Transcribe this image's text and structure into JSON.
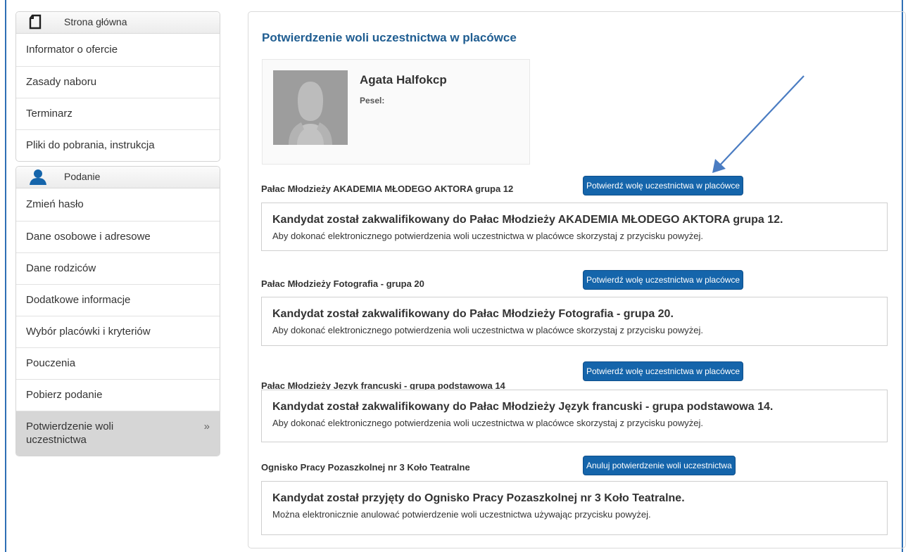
{
  "sidebar": {
    "home_panel": {
      "title": "Strona główna",
      "items": [
        "Informator o ofercie",
        "Zasady naboru",
        "Terminarz",
        "Pliki do pobrania, instrukcja"
      ]
    },
    "application_panel": {
      "title": "Podanie",
      "items": [
        "Zmień hasło",
        "Dane osobowe i adresowe",
        "Dane rodziców",
        "Dodatkowe informacje",
        "Wybór placówki i kryteriów",
        "Pouczenia",
        "Pobierz podanie"
      ],
      "active_item": "Potwierdzenie woli uczestnictwa",
      "active_chevron": "»"
    }
  },
  "main": {
    "title": "Potwierdzenie woli uczestnictwa w placówce",
    "candidate": {
      "name": "Agata Halfokcp",
      "pesel_label": "Pesel:"
    },
    "entries": [
      {
        "label": "Pałac Młodzieży AKADEMIA MŁODEGO AKTORA grupa 12",
        "button": "Potwierdź wolę uczestnictwa w placówce",
        "status": "Kandydat został zakwalifikowany do Pałac Młodzieży AKADEMIA MŁODEGO AKTORA grupa 12.",
        "info": "Aby dokonać elektronicznego potwierdzenia woli uczestnictwa w placówce skorzystaj z przycisku powyżej."
      },
      {
        "label": "Pałac Młodzieży Fotografia - grupa 20",
        "button": "Potwierdź wolę uczestnictwa w placówce",
        "status": "Kandydat został zakwalifikowany do Pałac Młodzieży Fotografia - grupa 20.",
        "info": "Aby dokonać elektronicznego potwierdzenia woli uczestnictwa w placówce skorzystaj z przycisku powyżej."
      },
      {
        "label": "Pałac Młodzieży Język francuski - grupa podstawowa 14",
        "button": "Potwierdź wolę uczestnictwa w placówce",
        "status": "Kandydat został zakwalifikowany do Pałac Młodzieży Język francuski - grupa podstawowa 14.",
        "info": "Aby dokonać elektronicznego potwierdzenia woli uczestnictwa w placówce skorzystaj z przycisku powyżej."
      },
      {
        "label": "Ognisko Pracy Pozaszkolnej nr 3 Koło Teatralne",
        "button": "Anuluj potwierdzenie woli uczestnictwa",
        "status": "Kandydat został przyjęty do Ognisko Pracy Pozaszkolnej nr 3 Koło Teatralne.",
        "info": "Można elektronicznie anulować potwierdzenie woli uczestnictwa używając przycisku powyżej."
      }
    ]
  },
  "icons": {
    "home_panel": "document-icon",
    "application_panel": "user-icon",
    "avatar": "person-silhouette-icon",
    "annotation": "arrow-annotation-icon"
  },
  "colors": {
    "accent": "#1565ab",
    "title": "#1f5d91",
    "frame": "#2e6fb5",
    "active_item_bg": "#d6d6d6"
  }
}
